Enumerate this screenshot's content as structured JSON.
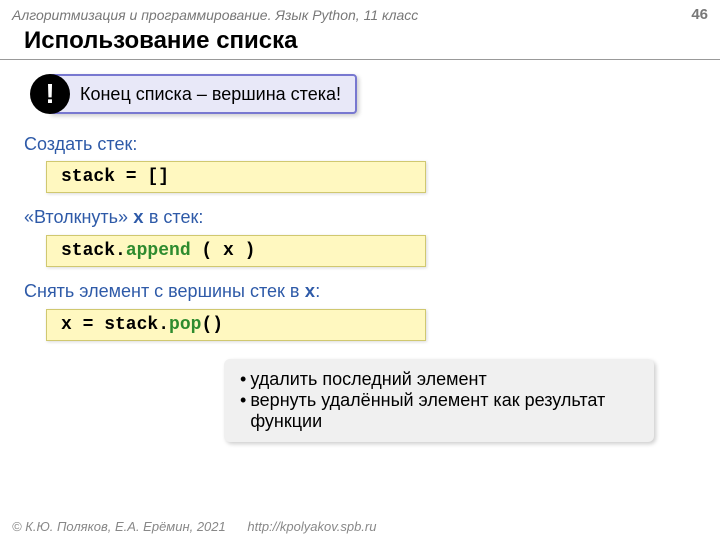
{
  "header": {
    "course": "Алгоритмизация и программирование. Язык Python, 11 класс",
    "page": "46"
  },
  "title": "Использование списка",
  "callout": {
    "mark": "!",
    "text": "Конец списка – вершина стека!"
  },
  "sections": {
    "create": {
      "label": "Создать стек:",
      "code_plain": "stack = []"
    },
    "push": {
      "label_pre": "«Втолкнуть» ",
      "label_var": "x",
      "label_post": " в стек:",
      "code_pre": "stack.",
      "code_method": "append",
      "code_post": " ( x )"
    },
    "pop": {
      "label_pre": "Снять элемент с вершины стек в ",
      "label_var": "x",
      "label_post": ":",
      "code_pre": "x = stack.",
      "code_method": "pop",
      "code_post": "()"
    }
  },
  "info": {
    "b1": "удалить последний элемент",
    "b2": "вернуть удалённый элемент как результат функции"
  },
  "footer": {
    "copy": "© К.Ю. Поляков, Е.А. Ерёмин, 2021",
    "url": "http://kpolyakov.spb.ru"
  }
}
